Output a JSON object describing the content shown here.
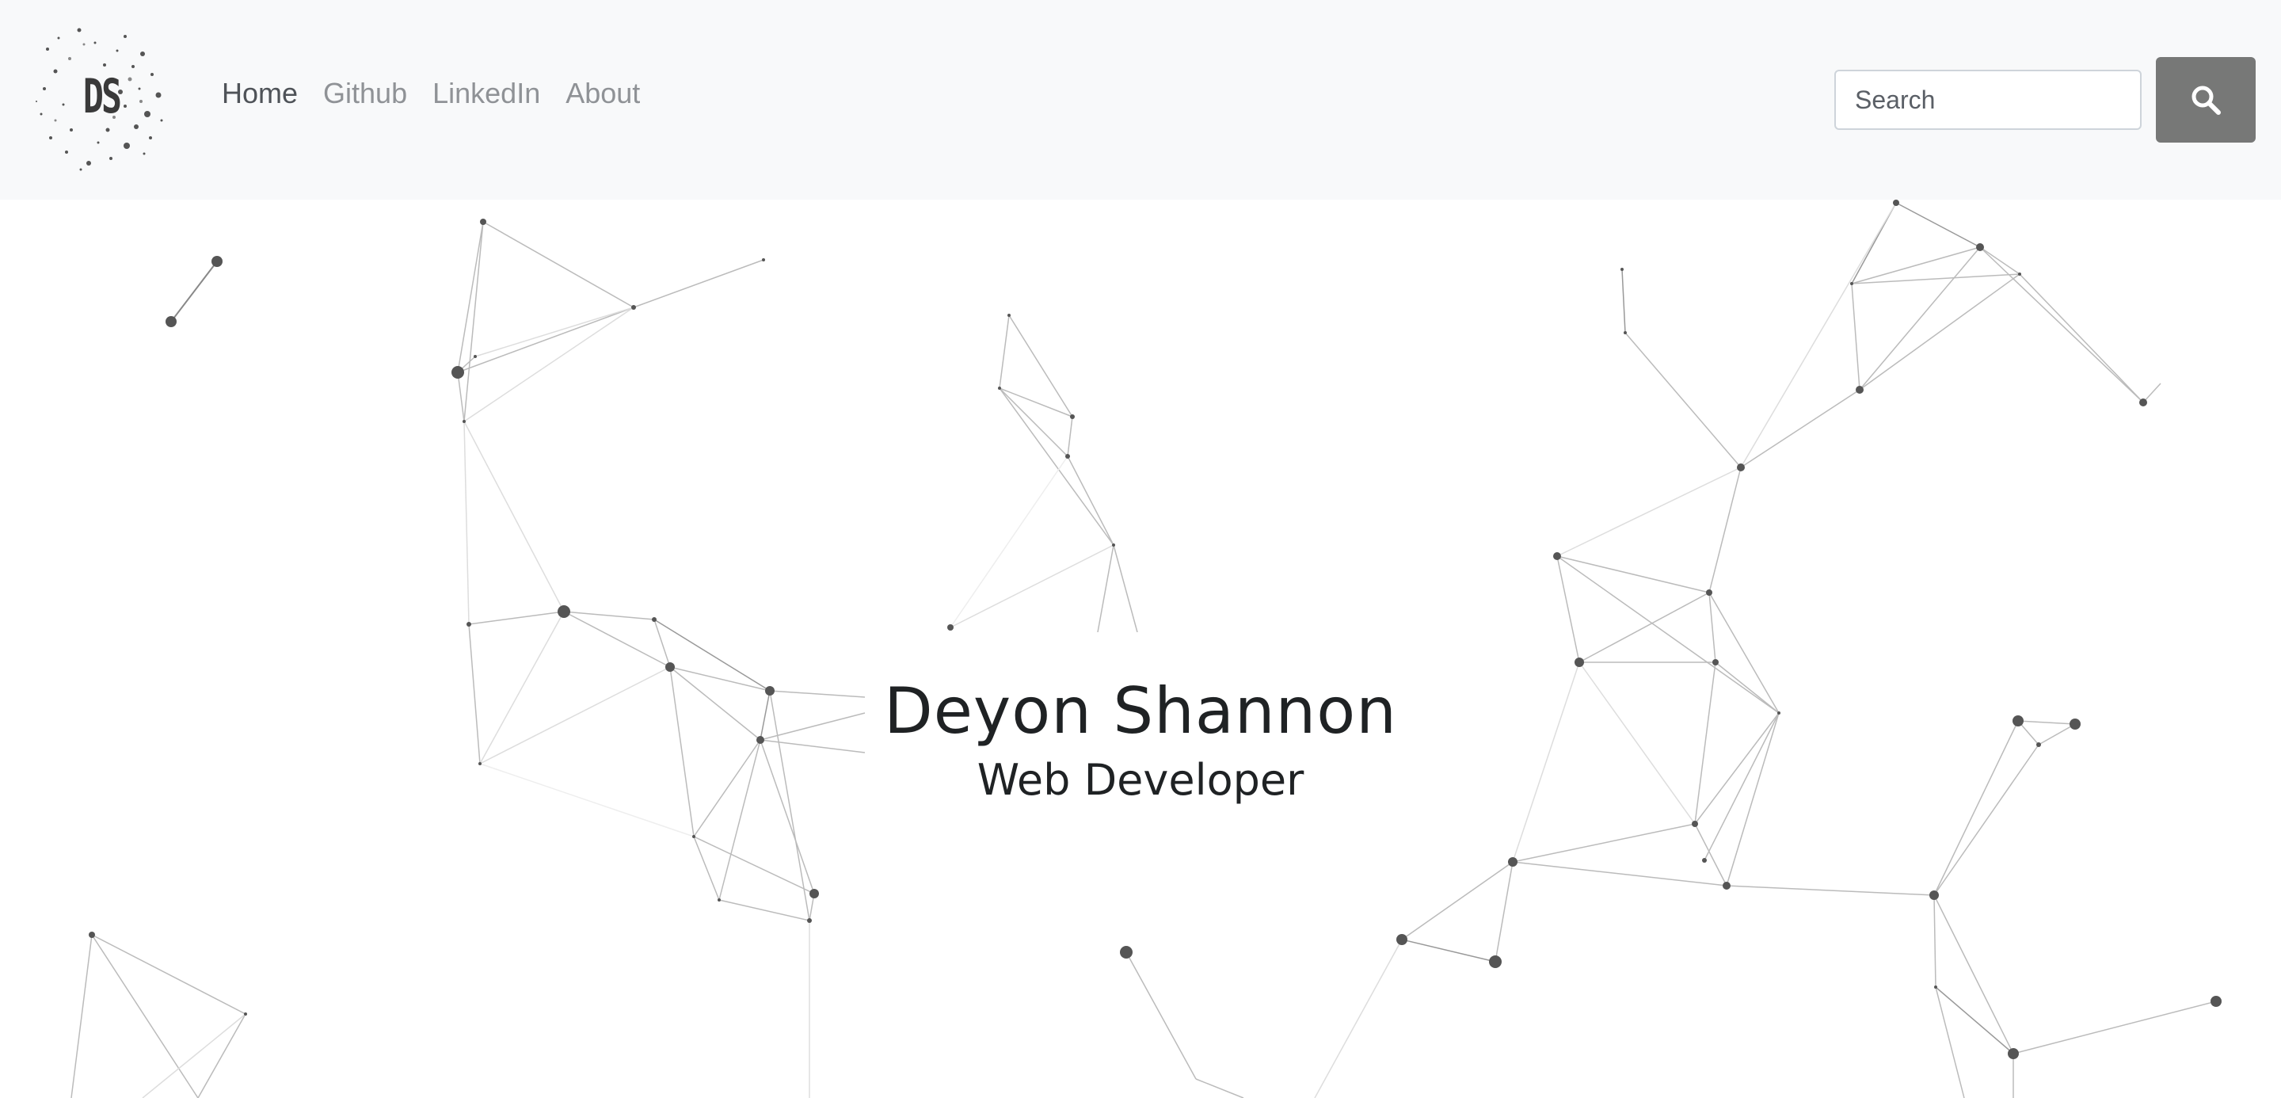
{
  "navbar": {
    "logo_text": "DS",
    "links": [
      {
        "label": "Home",
        "active": true
      },
      {
        "label": "Github",
        "active": false
      },
      {
        "label": "LinkedIn",
        "active": false
      },
      {
        "label": "About",
        "active": false
      }
    ],
    "search": {
      "placeholder": "Search",
      "button_icon": "search-icon"
    }
  },
  "hero": {
    "name": "Deyon Shannon",
    "title": "Web Developer"
  },
  "colors": {
    "navbar_bg": "#f8f9fa",
    "search_button_bg": "#777877",
    "text_dark": "#1f2224",
    "nav_inactive": "#8f9296",
    "network_node": "#555555"
  }
}
